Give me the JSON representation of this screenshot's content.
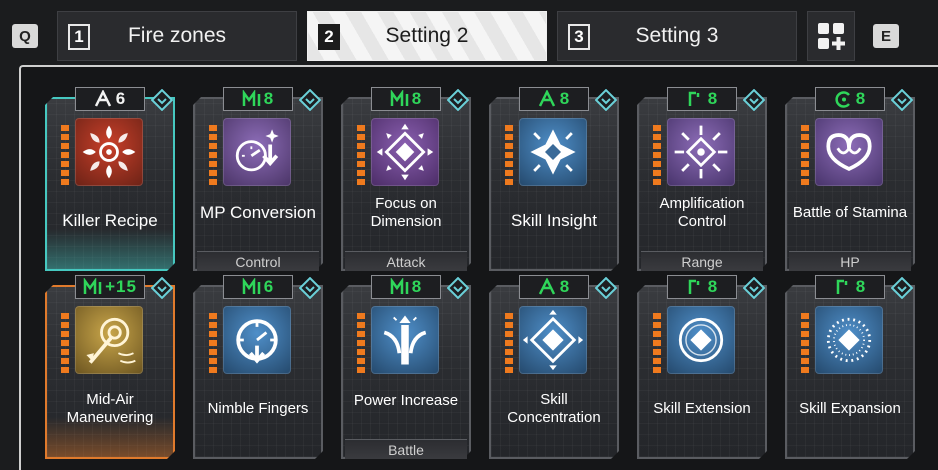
{
  "top_bar": {
    "key_left": "Q",
    "key_right": "E",
    "tabs": [
      {
        "num": "1",
        "label": "Fire zones",
        "active": false
      },
      {
        "num": "2",
        "label": "Setting 2",
        "active": true
      },
      {
        "num": "3",
        "label": "Setting 3",
        "active": false
      }
    ]
  },
  "cards": [
    {
      "name": "Killer Recipe",
      "cost": "6",
      "cost_icon": "ascent-icon",
      "cost_color": "white",
      "category": "",
      "bg": [
        "#c9402a",
        "#6b2216"
      ],
      "icon": "flame-burst-icon",
      "highlight": "teal"
    },
    {
      "name": "MP Conversion",
      "cost": "8",
      "cost_icon": "m-rune-icon",
      "cost_color": "green",
      "category": "Control",
      "bg": [
        "#8d6db8",
        "#4a3466"
      ],
      "icon": "gauge-arrow-icon",
      "highlight": ""
    },
    {
      "name": "Focus on Dimension",
      "cost": "8",
      "cost_icon": "m-rune-icon",
      "cost_color": "green",
      "category": "Attack",
      "bg": [
        "#8a5fb0",
        "#4b2c66"
      ],
      "icon": "diamond-burst-icon",
      "highlight": ""
    },
    {
      "name": "Skill Insight",
      "cost": "8",
      "cost_icon": "ascent-icon",
      "cost_color": "green",
      "category": "",
      "bg": [
        "#4f8fc9",
        "#24486b"
      ],
      "icon": "star-diamond-icon",
      "highlight": ""
    },
    {
      "name": "Amplification Control",
      "cost": "8",
      "cost_icon": "r-rune-icon",
      "cost_color": "green",
      "category": "Range",
      "bg": [
        "#8d6db8",
        "#47336a"
      ],
      "icon": "radiant-diamond-icon",
      "highlight": ""
    },
    {
      "name": "Battle of Stamina",
      "cost": "8",
      "cost_icon": "c-rune-icon",
      "cost_color": "green",
      "category": "HP",
      "bg": [
        "#8d6db8",
        "#47336a"
      ],
      "icon": "infinity-heart-icon",
      "highlight": ""
    },
    {
      "name": "Mid-Air Maneuvering",
      "cost": "+15",
      "cost_icon": "m-rune-icon",
      "cost_color": "green",
      "category": "",
      "bg": [
        "#c9a64a",
        "#6b5420"
      ],
      "icon": "grapple-hook-icon",
      "highlight": "orange"
    },
    {
      "name": "Nimble Fingers",
      "cost": "6",
      "cost_icon": "m-rune-icon",
      "cost_color": "green",
      "category": "",
      "bg": [
        "#4f8fc9",
        "#24486b"
      ],
      "icon": "dial-arrow-icon",
      "highlight": ""
    },
    {
      "name": "Power Increase",
      "cost": "8",
      "cost_icon": "m-rune-icon",
      "cost_color": "green",
      "category": "Battle",
      "bg": [
        "#4f8fc9",
        "#24486b"
      ],
      "icon": "rising-arrow-icon",
      "highlight": ""
    },
    {
      "name": "Skill Concentration",
      "cost": "8",
      "cost_icon": "ascent-icon",
      "cost_color": "green",
      "category": "",
      "bg": [
        "#4f8fc9",
        "#24486b"
      ],
      "icon": "nested-diamond-icon",
      "highlight": ""
    },
    {
      "name": "Skill Extension",
      "cost": "8",
      "cost_icon": "r-rune-icon",
      "cost_color": "green",
      "category": "",
      "bg": [
        "#4f8fc9",
        "#24486b"
      ],
      "icon": "ring-diamond-icon",
      "highlight": ""
    },
    {
      "name": "Skill Expansion",
      "cost": "8",
      "cost_icon": "r-rune-icon",
      "cost_color": "green",
      "category": "",
      "bg": [
        "#4f8fc9",
        "#24486b"
      ],
      "icon": "dotted-ring-diamond-icon",
      "highlight": ""
    }
  ]
}
